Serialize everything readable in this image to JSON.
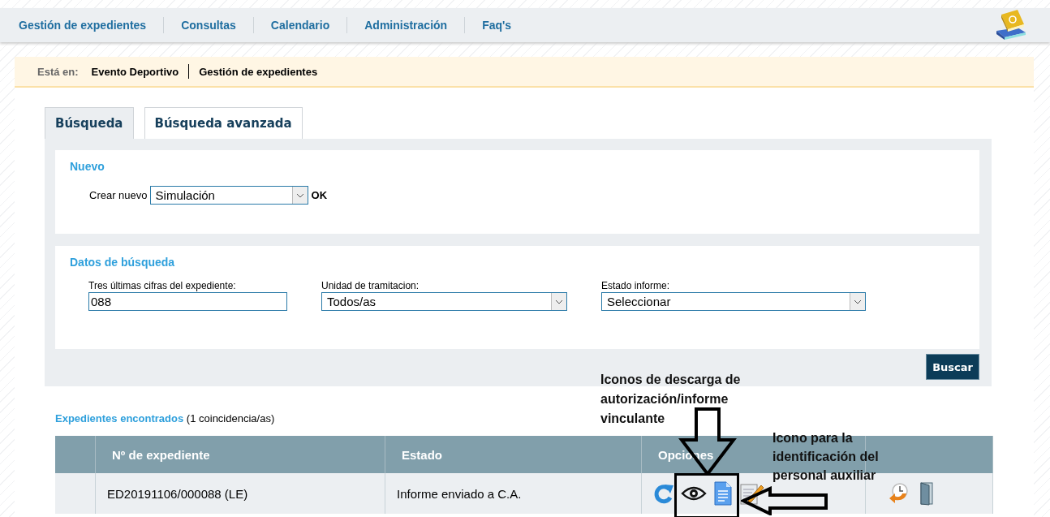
{
  "nav": {
    "items": [
      {
        "label": "Gestión de expedientes"
      },
      {
        "label": "Consultas"
      },
      {
        "label": "Calendario"
      },
      {
        "label": "Administración"
      },
      {
        "label": "Faq's"
      }
    ]
  },
  "breadcrumb": {
    "label": "Está en:",
    "items": [
      "Evento Deportivo",
      "Gestión de expedientes"
    ]
  },
  "tabs": [
    {
      "label": "Búsqueda",
      "selected": true
    },
    {
      "label": "Búsqueda avanzada",
      "selected": false
    }
  ],
  "nuevo": {
    "title": "Nuevo",
    "label": "Crear nuevo",
    "value": "Simulación",
    "ok": "OK"
  },
  "search": {
    "title": "Datos de búsqueda",
    "fields": [
      {
        "kind": "text",
        "label": "Tres últimas cifras del expediente:",
        "value": "088"
      },
      {
        "kind": "select",
        "label": "Unidad de tramitacion:",
        "value": "Todos/as"
      },
      {
        "kind": "select",
        "label": "Estado informe:",
        "value": "Seleccionar"
      }
    ],
    "button": "Buscar"
  },
  "results": {
    "title": "Expedientes encontrados",
    "count": "(1 coincidencia/as)",
    "columns": [
      "Nº de expediente",
      "Estado",
      "Opciones"
    ],
    "rows": [
      {
        "number": "ED20191106/000088 (LE)",
        "status": "Informe enviado a C.A."
      }
    ]
  },
  "annotations": [
    "Iconos de descarga de autorización/informe vinculante",
    "Icono para la identificación del personal auxiliar"
  ]
}
